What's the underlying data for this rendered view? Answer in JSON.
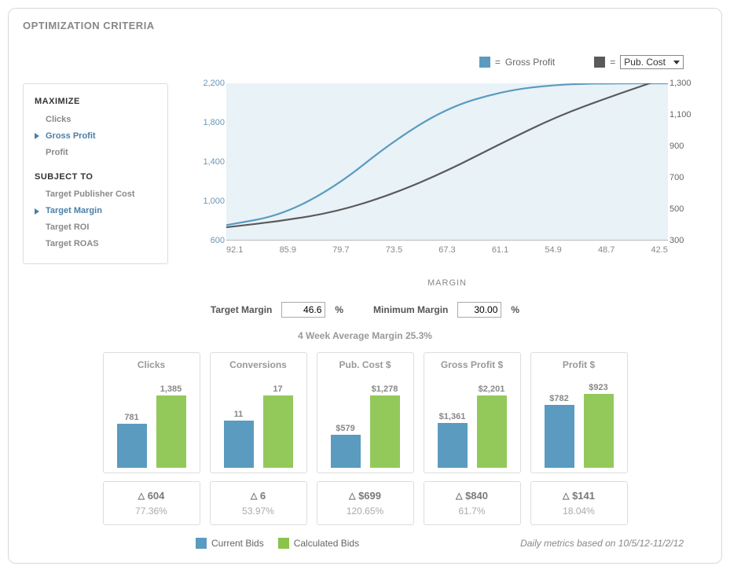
{
  "panel": {
    "title": "OPTIMIZATION CRITERIA"
  },
  "legend_top": {
    "series1_prefix": "= ",
    "series1_name": "Gross Profit",
    "series2_prefix": "= ",
    "dropdown_value": "Pub. Cost"
  },
  "sidebar": {
    "maximize_heading": "MAXIMIZE",
    "maximize": [
      {
        "label": "Clicks",
        "selected": false
      },
      {
        "label": "Gross Profit",
        "selected": true
      },
      {
        "label": "Profit",
        "selected": false
      }
    ],
    "subject_heading": "SUBJECT TO",
    "subject": [
      {
        "label": "Target Publisher Cost",
        "selected": false
      },
      {
        "label": "Target Margin",
        "selected": true
      },
      {
        "label": "Target ROI",
        "selected": false
      },
      {
        "label": "Target ROAS",
        "selected": false
      }
    ]
  },
  "chart_data": {
    "type": "line",
    "xlabel": "MARGIN",
    "x_ticks": [
      "92.1",
      "85.9",
      "79.7",
      "73.5",
      "67.3",
      "61.1",
      "54.9",
      "48.7",
      "42.5"
    ],
    "y_left": {
      "min": 600,
      "max": 2200,
      "ticks": [
        "2,200",
        "1,800",
        "1,400",
        "1,000",
        "600"
      ]
    },
    "y_right": {
      "min": 300,
      "max": 1300,
      "ticks": [
        "1,300",
        "1,100",
        "900",
        "700",
        "500",
        "300"
      ]
    },
    "series": [
      {
        "name": "Gross Profit",
        "axis": "left",
        "color": "#5a9bbf",
        "y": [
          750,
          850,
          1150,
          1600,
          1950,
          2120,
          2190,
          2200,
          2200
        ]
      },
      {
        "name": "Pub. Cost",
        "axis": "right",
        "color": "#5a5a5a",
        "y": [
          380,
          420,
          480,
          590,
          740,
          920,
          1090,
          1220,
          1340
        ]
      }
    ]
  },
  "inputs": {
    "target_label": "Target Margin",
    "target_value": "46.6",
    "target_suffix": "%",
    "min_label": "Minimum Margin",
    "min_value": "30.00",
    "min_suffix": "%"
  },
  "avg_line": "4 Week Average Margin 25.3%",
  "metrics": [
    {
      "title": "Clicks",
      "current": "781",
      "calc": "1,385",
      "ch": 56,
      "xh": 92,
      "delta": "604",
      "pct": "77.36%"
    },
    {
      "title": "Conversions",
      "current": "11",
      "calc": "17",
      "ch": 60,
      "xh": 92,
      "delta": "6",
      "pct": "53.97%"
    },
    {
      "title": "Pub. Cost $",
      "current": "$579",
      "calc": "$1,278",
      "ch": 42,
      "xh": 92,
      "delta": "$699",
      "pct": "120.65%"
    },
    {
      "title": "Gross Profit $",
      "current": "$1,361",
      "calc": "$2,201",
      "ch": 57,
      "xh": 92,
      "delta": "$840",
      "pct": "61.7%"
    },
    {
      "title": "Profit $",
      "current": "$782",
      "calc": "$923",
      "ch": 80,
      "xh": 94,
      "delta": "$141",
      "pct": "18.04%"
    }
  ],
  "legend_bottom": {
    "current": "Current Bids",
    "calc": "Calculated Bids",
    "note": "Daily metrics based on 10/5/12-11/2/12"
  }
}
